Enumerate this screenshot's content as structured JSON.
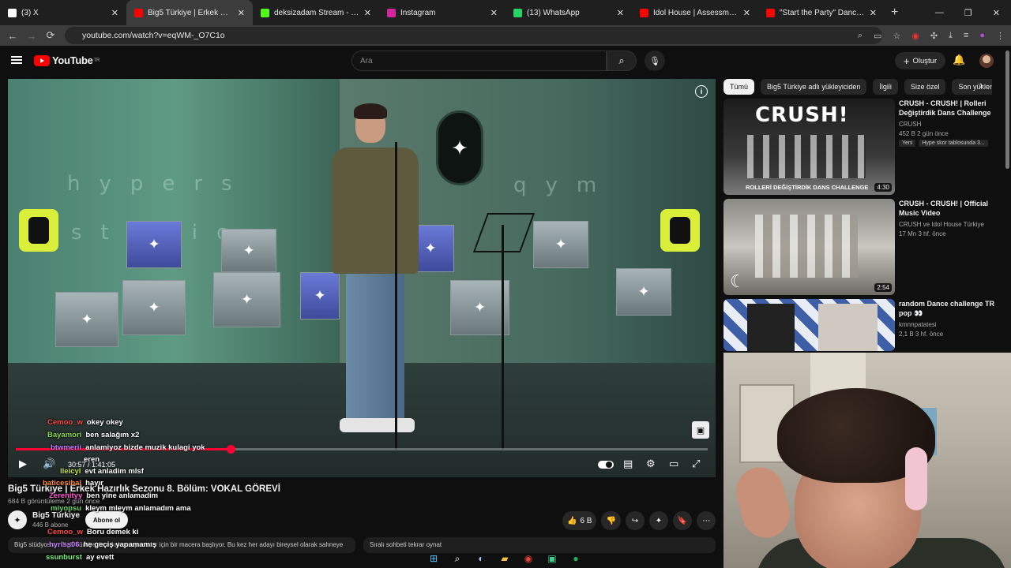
{
  "browser": {
    "tabs": [
      {
        "label": "(3) X",
        "fav_color": "#ffffff"
      },
      {
        "label": "Big5 Türkiye | Erkek Hazırlık",
        "fav_color": "#ff0000"
      },
      {
        "label": "deksizadam Stream - Watch Li",
        "fav_color": "#53fc18"
      },
      {
        "label": "Instagram",
        "fav_color": "#d6249f"
      },
      {
        "label": "(13) WhatsApp",
        "fav_color": "#25d366"
      },
      {
        "label": "Idol House | Assessment 2 | Ad",
        "fav_color": "#ff0000"
      },
      {
        "label": "\"Start the Party\" Dance Class w",
        "fav_color": "#ff0000"
      }
    ],
    "url": "youtube.com/watch?v=eqWM-_O7C1o"
  },
  "header": {
    "logo_text": "YouTube",
    "logo_sup": "TR",
    "search_placeholder": "Ara",
    "create_label": "Oluştur"
  },
  "player": {
    "wall_text_1": "hypers",
    "wall_text_2": "studio",
    "wall_text_3": "qym",
    "time": "30:57 / 1:41:05",
    "progress": 0.31
  },
  "video": {
    "title": "Big5 Türkiye | Erkek Hazırlık Sezonu 8. Bölüm: VOKAL GÖREVİ",
    "views": "684 B görüntüleme  2 gün önce",
    "channel": "Big5 Türkiye",
    "subs": "446 B abone",
    "subscribe_label": "Abone ol",
    "likes": "6 B",
    "description": "Big5 stüdyosu... Big5 Türkiye'de erkek yarışmacılar için bir macera başlıyor. Bu kez her adayı bireysel olarak sahneye",
    "comments_hint": "Sıralı sohbeti tekrar oynat"
  },
  "chat": [
    {
      "user": "Cemoo_w",
      "text": "okey okey",
      "color": "#ff4b4b"
    },
    {
      "user": "Bayamori",
      "text": "ben salağım x2",
      "color": "#8ad94a"
    },
    {
      "user": "btwmerii",
      "text": "anlamiyoz bizde muzik kulagi yok",
      "color": "#c77dff"
    },
    {
      "user": "eren",
      "text": "",
      "color": "#ffffff"
    },
    {
      "user": "lleicyl",
      "text": "evt anladim mlsf",
      "color": "#c2e64a"
    },
    {
      "user": "baticesibal",
      "text": "hayır",
      "color": "#ff8c3b"
    },
    {
      "user": "Zerenityy",
      "text": "ben yine anlamadim",
      "color": "#ff5ad3"
    },
    {
      "user": "miyopsu",
      "text": "kleym mleym anlamadım ama",
      "color": "#6bd66b"
    },
    {
      "user": "Cemoo_w",
      "text": "Boru demek ki",
      "color": "#ff4b4b"
    },
    {
      "user": "hyriss06",
      "text": "he geçiş yapamamış",
      "color": "#c77dff"
    },
    {
      "user": "ssunburst",
      "text": "ay evett",
      "color": "#7cf07c"
    }
  ],
  "chips": [
    "Tümü",
    "Big5 Türkiye adlı yükleyiciden",
    "İlgili",
    "Size özel",
    "Son yüklenen"
  ],
  "recommendations": [
    {
      "title": "CRUSH - CRUSH! | Rolleri Değiştirdik Dans Challenge",
      "channel": "CRUSH",
      "meta": "452 B  2 gün önce",
      "badge_new": "Yeni",
      "badge_extra": "Hype skor tablosunda 3...",
      "duration": "4:30",
      "thumb_text": "CRUSH!",
      "thumb_caption": "ROLLERİ DEĞİŞTİRDİK DANS CHALLENGE"
    },
    {
      "title": "CRUSH - CRUSH! | Official Music Video",
      "channel": "CRUSH ve Idol House Türkiye",
      "meta": "17 Mn  3 hf. önce",
      "duration": "2:54"
    },
    {
      "title": "random Dance challenge TR pop 👀",
      "channel": "kmnnpatatesi",
      "meta": "2,1 B  3 hf. önce"
    }
  ],
  "icons": {
    "search": "search-icon",
    "mic": "mic-icon",
    "bell": "bell-icon"
  }
}
